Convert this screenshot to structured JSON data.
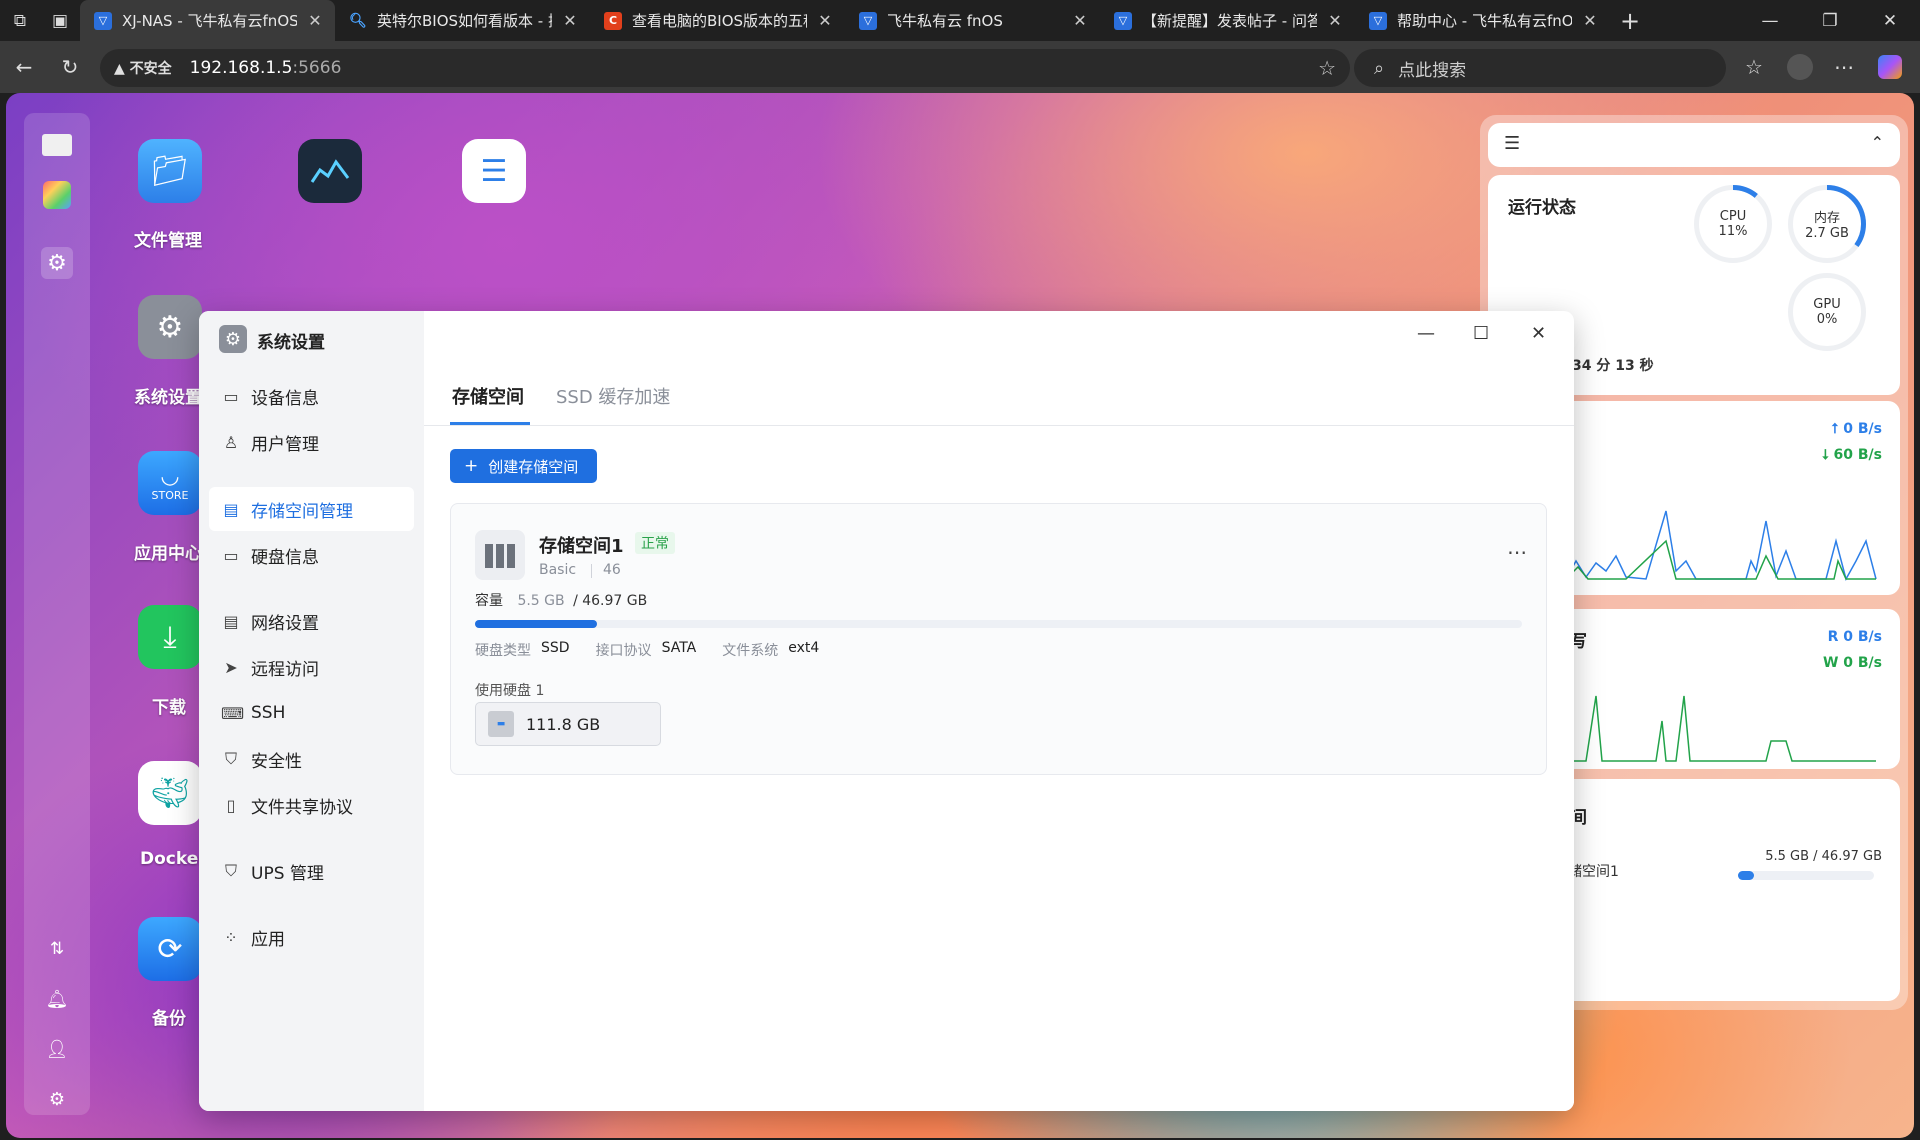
{
  "browser": {
    "tabs": [
      {
        "label": "XJ-NAS - 飞牛私有云fnOS",
        "icon": "fnos-favicon-icon",
        "active": true
      },
      {
        "label": "英特尔BIOS如何看版本 - 搜",
        "icon": "bing-search-icon"
      },
      {
        "label": "查看电脑的BIOS版本的五种",
        "icon": "csdn-favicon-icon"
      },
      {
        "label": "飞牛私有云 fnOS",
        "icon": "fnos-favicon-icon"
      },
      {
        "label": "【新提醒】发表帖子 - 问答",
        "icon": "fnos-favicon-icon"
      },
      {
        "label": "帮助中心 - 飞牛私有云fnOS",
        "icon": "fnos-favicon-icon"
      }
    ],
    "address": {
      "security_label": "不安全",
      "host": "192.168.1.5",
      "port": ":5666"
    },
    "search_placeholder": "点此搜索"
  },
  "desktop": {
    "icons": [
      {
        "label": "文件管理",
        "icon": "folder-icon"
      },
      {
        "label": "",
        "icon": "resource-monitor-icon"
      },
      {
        "label": "",
        "icon": "storage-manager-icon"
      },
      {
        "label": "系统设置",
        "icon": "gear-icon"
      },
      {
        "label": "应用中心",
        "icon": "store-icon",
        "badge": "STORE"
      },
      {
        "label": "下载",
        "icon": "download-icon"
      },
      {
        "label": "Docker",
        "icon": "docker-icon"
      },
      {
        "label": "备份",
        "icon": "backup-sync-icon"
      }
    ]
  },
  "widgets": {
    "status": {
      "title": "运行状态",
      "cpu_label": "CPU",
      "cpu_value": "11%",
      "cpu_fraction": 0.11,
      "mem_label": "内存",
      "mem_value": "2.7 GB",
      "mem_fraction": 0.35,
      "gpu_label": "GPU",
      "gpu_value": "0%",
      "gpu_fraction": 0,
      "uptime": "34 分 13 秒"
    },
    "network": {
      "up": "0 B/s",
      "down": "60 B/s"
    },
    "disk": {
      "title_fragment": "写",
      "read": "R  0 B/s",
      "write": "W  0 B/s"
    },
    "storage": {
      "title_fragment": "间",
      "pool_name": "储空间1",
      "usage": "5.5 GB / 46.97 GB",
      "usage_fraction": 0.117
    }
  },
  "settings": {
    "title": "系统设置",
    "menu": [
      {
        "label": "设备信息",
        "icon": "device-info-icon"
      },
      {
        "label": "用户管理",
        "icon": "user-icon"
      },
      {
        "label": "存储空间管理",
        "icon": "storage-icon",
        "active": true
      },
      {
        "label": "硬盘信息",
        "icon": "harddisk-icon"
      },
      {
        "label": "网络设置",
        "icon": "network-icon"
      },
      {
        "label": "远程访问",
        "icon": "remote-access-icon"
      },
      {
        "label": "SSH",
        "icon": "ssh-icon"
      },
      {
        "label": "安全性",
        "icon": "shield-icon"
      },
      {
        "label": "文件共享协议",
        "icon": "file-share-icon"
      },
      {
        "label": "UPS 管理",
        "icon": "ups-icon"
      },
      {
        "label": "应用",
        "icon": "apps-icon"
      }
    ],
    "tabs": [
      {
        "label": "存储空间",
        "active": true
      },
      {
        "label": "SSD 缓存加速"
      }
    ],
    "create_button": "创建存储空间",
    "pool": {
      "name": "存储空间1",
      "status": "正常",
      "raid": "Basic",
      "id": "46",
      "capacity_label": "容量",
      "used": "5.5 GB",
      "total": "/ 46.97 GB",
      "used_fraction": 0.117,
      "disk_type_label": "硬盘类型",
      "disk_type": "SSD",
      "interface_label": "接口协议",
      "interface": "SATA",
      "fs_label": "文件系统",
      "fs": "ext4",
      "used_disks_label": "使用硬盘 1",
      "disk_size": "111.8 GB"
    }
  }
}
